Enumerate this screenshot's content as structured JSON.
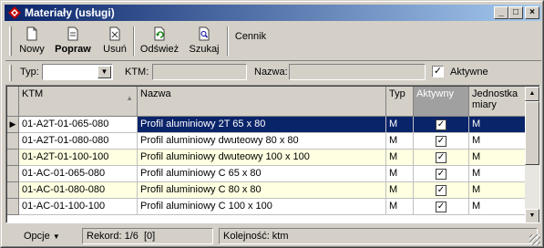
{
  "window": {
    "title": "Materiały (usługi)",
    "min_symbol": "_",
    "max_symbol": "□",
    "close_symbol": "×"
  },
  "toolbar": {
    "new_label": "Nowy",
    "edit_label": "Popraw",
    "delete_label": "Usuń",
    "refresh_label": "Odśwież",
    "search_label": "Szukaj",
    "pricelist_label": "Cennik"
  },
  "filters": {
    "type_label": "Typ:",
    "type_value": "",
    "ktm_label": "KTM:",
    "ktm_value": "",
    "name_label": "Nazwa:",
    "name_value": "",
    "active_label": "Aktywne",
    "active_checked": "✓"
  },
  "grid": {
    "columns": {
      "ktm": "KTM",
      "nazwa": "Nazwa",
      "typ": "Typ",
      "aktywny": "Aktywny",
      "jednostka": "Jednostka miary"
    },
    "rows": [
      {
        "ktm": "01-A2T-01-065-080",
        "nazwa": "Profil aluminiowy 2T 65 x 80",
        "typ": "M",
        "aktywny": "✓",
        "jednostka": "M"
      },
      {
        "ktm": "01-A2T-01-080-080",
        "nazwa": "Profil aluminiowy dwuteowy 80 x 80",
        "typ": "M",
        "aktywny": "✓",
        "jednostka": "M"
      },
      {
        "ktm": "01-A2T-01-100-100",
        "nazwa": "Profil aluminiowy dwuteowy 100 x 100",
        "typ": "M",
        "aktywny": "✓",
        "jednostka": "M"
      },
      {
        "ktm": "01-AC-01-065-080",
        "nazwa": "Profil aluminiowy C 65 x 80",
        "typ": "M",
        "aktywny": "✓",
        "jednostka": "M"
      },
      {
        "ktm": "01-AC-01-080-080",
        "nazwa": "Profil aluminiowy C 80 x 80",
        "typ": "M",
        "aktywny": "✓",
        "jednostka": "M"
      },
      {
        "ktm": "01-AC-01-100-100",
        "nazwa": "Profil aluminiowy C 100 x 100",
        "typ": "M",
        "aktywny": "✓",
        "jednostka": "M"
      }
    ],
    "row_indicator": "▶"
  },
  "status": {
    "options_label": "Opcje",
    "record_label": "Rekord: 1/6  [0]",
    "order_label": "Kolejność: ktm"
  },
  "colors": {
    "title_start": "#0a246a",
    "title_end": "#a6caf0",
    "selection": "#0a246a",
    "alt_row": "#ffffe1",
    "face": "#d4d0c8"
  }
}
